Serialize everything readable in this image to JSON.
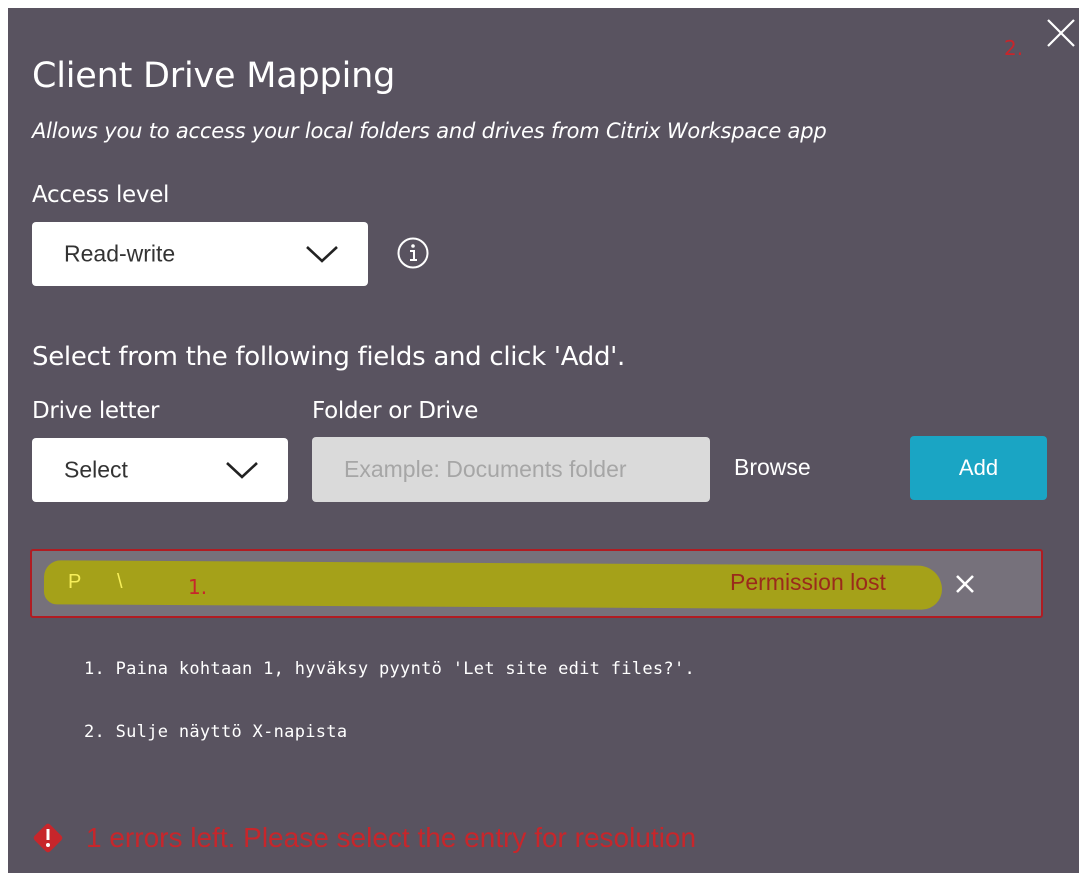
{
  "dialog": {
    "title": "Client Drive Mapping",
    "subtitle": "Allows you to access your local folders and drives from Citrix Workspace app",
    "close_annotation": "2."
  },
  "access": {
    "label": "Access level",
    "selected": "Read-write",
    "info_icon": "info-icon"
  },
  "add_section": {
    "heading": "Select from the following fields and click 'Add'.",
    "drive_letter_label": "Drive letter",
    "drive_letter_selected": "Select",
    "folder_label": "Folder or Drive",
    "folder_placeholder": "Example: Documents folder",
    "browse_label": "Browse",
    "add_label": "Add"
  },
  "entries": [
    {
      "drive": "P",
      "path": "\\",
      "annotation": "1.",
      "status": "Permission lost",
      "status_color": "#9a2a1b",
      "highlight_color": "#a5a119"
    }
  ],
  "instructions": [
    "1. Paina kohtaan 1, hyväksy pyyntö 'Let site edit files?'.",
    "2. Sulje näyttö X-napista"
  ],
  "error": {
    "icon": "warning-diamond-icon",
    "text": "1 errors left. Please select the entry for resolution",
    "color": "#c7262b"
  },
  "colors": {
    "background": "#595360",
    "accent": "#1aa5c4",
    "error_border": "#b01c22"
  }
}
